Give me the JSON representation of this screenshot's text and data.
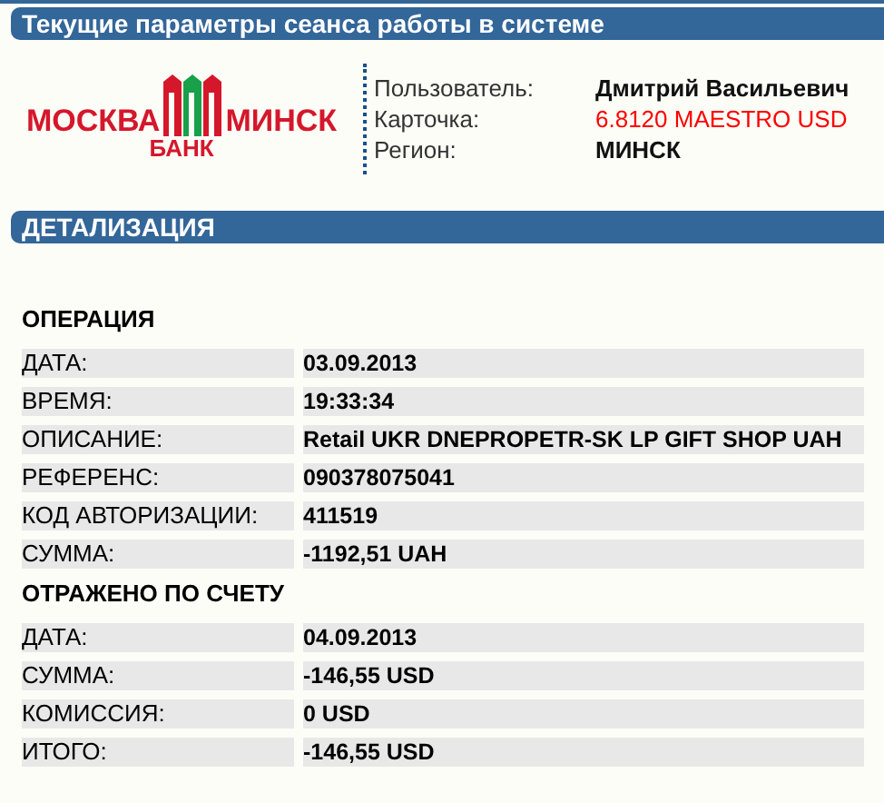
{
  "session_header": "Текущие параметры сеанса работы в системе",
  "logo": {
    "left": "МОСКВА",
    "right": "МИНСК",
    "bottom": "БАНК"
  },
  "session_info": [
    {
      "label": "Пользователь:",
      "value": "Дмитрий Васильевич",
      "kind": "normal"
    },
    {
      "label": "Карточка:",
      "value": "6.8120 MAESTRO USD",
      "kind": "highlight"
    },
    {
      "label": "Регион:",
      "value": "МИНСК",
      "kind": "normal"
    }
  ],
  "details_header": "ДЕТАЛИЗАЦИЯ",
  "sections": [
    {
      "title": "ОПЕРАЦИЯ",
      "rows": [
        {
          "label": "ДАТА:",
          "value": "03.09.2013"
        },
        {
          "label": "ВРЕМЯ:",
          "value": "19:33:34"
        },
        {
          "label": "ОПИСАНИЕ:",
          "value": "Retail UKR DNEPROPETR-SK LP GIFT SHOP UAH"
        },
        {
          "label": "РЕФЕРЕНС:",
          "value": "090378075041"
        },
        {
          "label": "КОД АВТОРИЗАЦИИ:",
          "value": "411519"
        },
        {
          "label": "СУММА:",
          "value": "-1192,51 UAH"
        }
      ]
    },
    {
      "title": "ОТРАЖЕНО ПО СЧЕТУ",
      "rows": [
        {
          "label": "ДАТА:",
          "value": "04.09.2013"
        },
        {
          "label": "СУММА:",
          "value": "-146,55 USD"
        },
        {
          "label": "КОМИССИЯ:",
          "value": "0 USD"
        },
        {
          "label": "ИТОГО:",
          "value": "-146,55 USD"
        }
      ]
    }
  ]
}
